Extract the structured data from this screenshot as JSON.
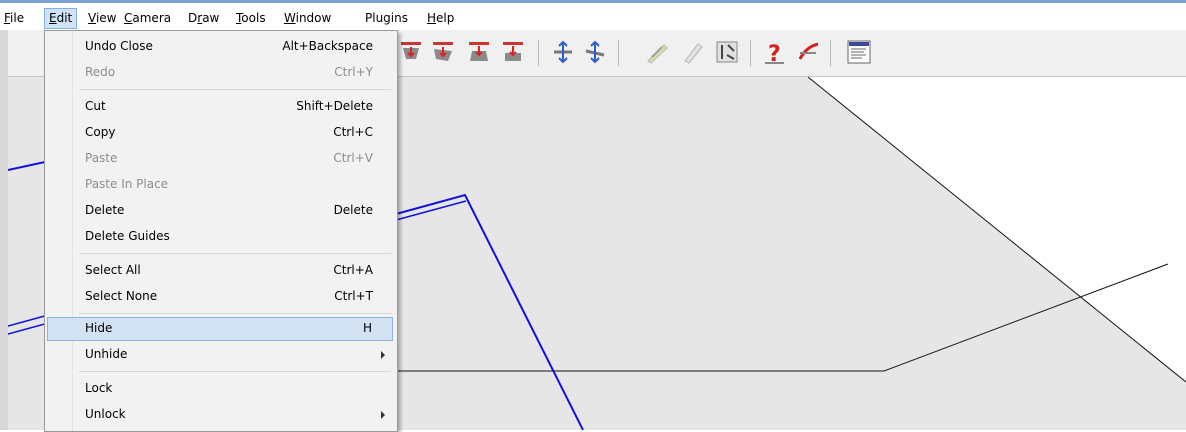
{
  "menubar": {
    "items": [
      {
        "label": "File",
        "key": "F",
        "rest": "ile"
      },
      {
        "label": "Edit",
        "key": "E",
        "rest": "dit"
      },
      {
        "label": "View",
        "key": "V",
        "rest": "iew"
      },
      {
        "label": "Camera",
        "key": "C",
        "rest": "amera"
      },
      {
        "label": "Draw",
        "pre": "D",
        "key": "r",
        "rest": "aw"
      },
      {
        "label": "Tools",
        "key": "T",
        "rest": "ools"
      },
      {
        "label": "Window",
        "key": "W",
        "rest": "indow"
      },
      {
        "label": "Plugins",
        "key": "",
        "rest": "Plugins"
      },
      {
        "label": "Help",
        "key": "H",
        "rest": "elp"
      }
    ]
  },
  "edit_menu": {
    "items": [
      {
        "label": "Undo Close",
        "shortcut": "Alt+Backspace",
        "enabled": true
      },
      {
        "label": "Redo",
        "shortcut": "Ctrl+Y",
        "enabled": false
      },
      {
        "label": "Cut",
        "shortcut": "Shift+Delete",
        "enabled": true
      },
      {
        "label": "Copy",
        "shortcut": "Ctrl+C",
        "enabled": true
      },
      {
        "label": "Paste",
        "shortcut": "Ctrl+V",
        "enabled": false
      },
      {
        "label": "Paste In Place",
        "shortcut": "",
        "enabled": false
      },
      {
        "label": "Delete",
        "shortcut": "Delete",
        "enabled": true
      },
      {
        "label": "Delete Guides",
        "shortcut": "",
        "enabled": true
      },
      {
        "label": "Select All",
        "shortcut": "Ctrl+A",
        "enabled": true
      },
      {
        "label": "Select None",
        "shortcut": "Ctrl+T",
        "enabled": true
      },
      {
        "label": "Hide",
        "shortcut": "H",
        "enabled": true,
        "highlighted": true
      },
      {
        "label": "Unhide",
        "shortcut": "",
        "enabled": true,
        "submenu": true
      },
      {
        "label": "Lock",
        "shortcut": "",
        "enabled": true
      },
      {
        "label": "Unlock",
        "shortcut": "",
        "enabled": true,
        "submenu": true
      }
    ]
  },
  "toolbar": {
    "icons": [
      "align-top-icon",
      "align-middle-icon",
      "align-bottom-icon",
      "align-bottom-alt-icon",
      "distribute-vertical-icon",
      "distribute-horizontal-icon",
      "follow-path-icon",
      "follow-path-alt-icon",
      "layout-grid-icon",
      "question-red-icon",
      "pen-red-icon",
      "list-window-icon"
    ]
  },
  "colors": {
    "menu_highlight": "#d3e2f3",
    "edge_blue": "#1010e0",
    "face_gray": "#e4e4e4"
  }
}
